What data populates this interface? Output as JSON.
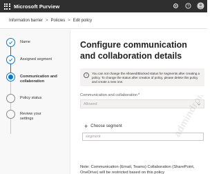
{
  "app": {
    "title": "Microsoft Purview",
    "icons": [
      "waffle-icon",
      "gear-icon",
      "help-icon",
      "avatar"
    ]
  },
  "breadcrumb": {
    "items": [
      "Information barrier",
      "Policies",
      "Edit policy"
    ],
    "separator": ">"
  },
  "stepper": {
    "steps": [
      {
        "label": "Name",
        "state": "done"
      },
      {
        "label": "Assigned segment",
        "state": "done"
      },
      {
        "label": "Communication and collaboration",
        "state": "current"
      },
      {
        "label": "Policy status",
        "state": "pending"
      },
      {
        "label": "Review your settings",
        "state": "pending"
      }
    ]
  },
  "main": {
    "title": "Configure communication and collaboration details",
    "info": {
      "icon": "info-icon",
      "text": "You can not change the Allowed/Blocked status for segments after creating a policy. To change the status after creation of policy, please delete this policy and create a new one."
    },
    "comm_field": {
      "label": "Communication and collaboration",
      "required_mark": "*",
      "value": "Allowed"
    },
    "choose_segment": {
      "label": "Choose segment",
      "icon": "plus-icon"
    },
    "segment_input": {
      "value": "segment"
    },
    "note": "Note: Communication (Email, Teams) Collaboration (SharePoint, OneDrive) will be restricted based on this policy"
  },
  "watermark": {
    "text": "admindroid.com"
  },
  "colors": {
    "topbar": "#2f2f2f",
    "accent": "#0078d4",
    "stepper_bg": "#f8f8f8"
  }
}
